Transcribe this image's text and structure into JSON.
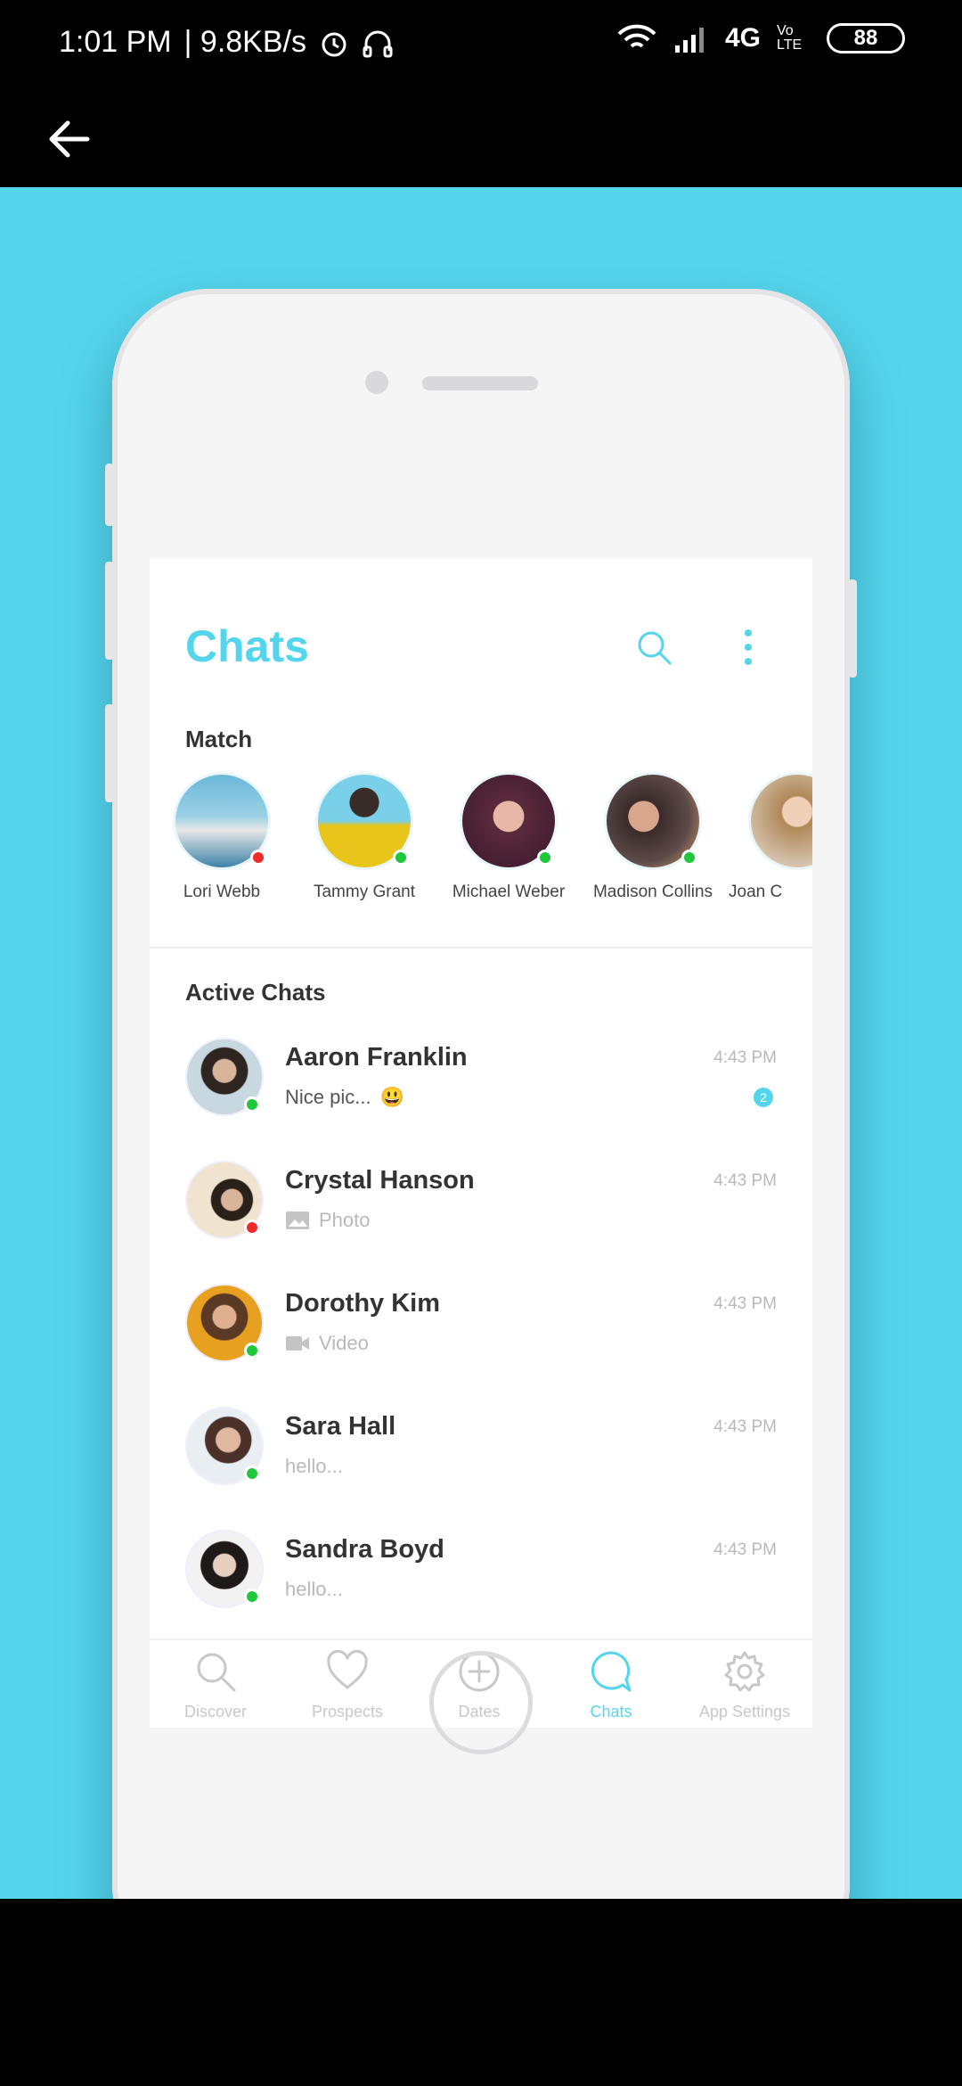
{
  "status_bar": {
    "time": "1:01 PM",
    "speed": "| 9.8KB/s",
    "network": "4G",
    "volte": "Vo LTE",
    "battery": "88"
  },
  "screen": {
    "title": "Chats",
    "match_label": "Match",
    "active_label": "Active Chats"
  },
  "matches": [
    {
      "name": "Lori Webb",
      "status": "#f02b2b"
    },
    {
      "name": "Tammy Grant",
      "status": "#1fc83a"
    },
    {
      "name": "Michael Weber",
      "status": "#1fc83a"
    },
    {
      "name": "Madison Collins",
      "status": "#1fc83a"
    },
    {
      "name": "Joan C",
      "status": ""
    }
  ],
  "chats": [
    {
      "name": "Aaron Franklin",
      "message": "Nice pic...",
      "emoji": "😃",
      "time": "4:43 PM",
      "unread": "2",
      "status": "#1fc83a",
      "kind": "text"
    },
    {
      "name": "Crystal Hanson",
      "message": "Photo",
      "time": "4:43 PM",
      "status": "#f02b2b",
      "kind": "photo"
    },
    {
      "name": "Dorothy Kim",
      "message": "Video",
      "time": "4:43 PM",
      "status": "#1fc83a",
      "kind": "video"
    },
    {
      "name": "Sara Hall",
      "message": "hello...",
      "time": "4:43 PM",
      "status": "#1fc83a",
      "kind": "text"
    },
    {
      "name": "Sandra Boyd",
      "message": "hello...",
      "time": "4:43 PM",
      "status": "#1fc83a",
      "kind": "text"
    }
  ],
  "tabs": [
    {
      "label": "Discover",
      "icon": "search-icon"
    },
    {
      "label": "Prospects",
      "icon": "heart-icon"
    },
    {
      "label": "Dates",
      "icon": "plus-circle-icon"
    },
    {
      "label": "Chats",
      "icon": "chat-bubble-icon",
      "active": true
    },
    {
      "label": "App Settings",
      "icon": "gear-icon"
    }
  ],
  "colors": {
    "accent": "#55d5ec",
    "background": "#55d5ec"
  }
}
